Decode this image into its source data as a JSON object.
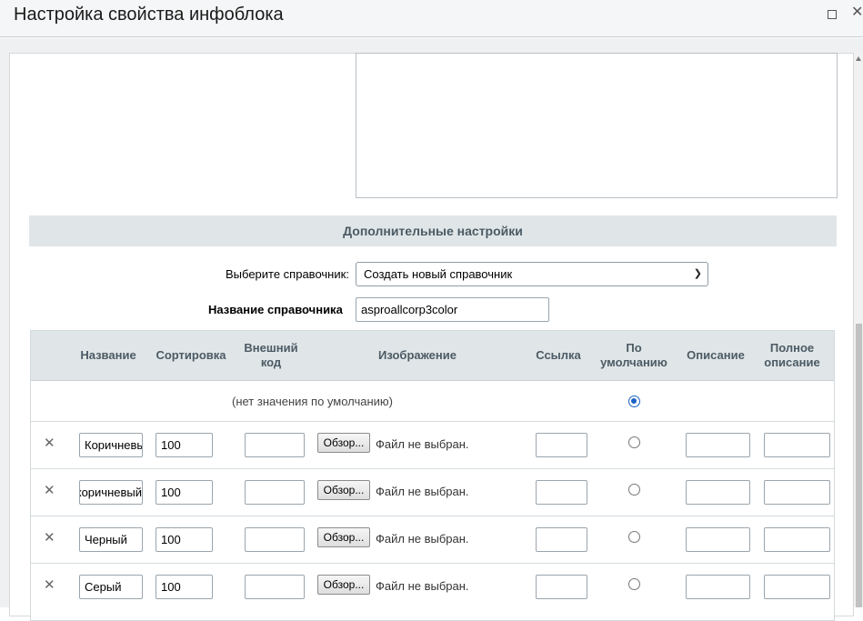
{
  "window": {
    "title": "Настройка свойства инфоблока"
  },
  "section": {
    "title": "Дополнительные настройки"
  },
  "directory": {
    "select_label": "Выберите справочник:",
    "select_value": "Создать новый справочник",
    "name_label": "Название справочника",
    "name_value": "asproallcorp3color"
  },
  "table": {
    "headers": {
      "name": "Название",
      "sort": "Сортировка",
      "ext_code": "Внешний\nкод",
      "image": "Изображение",
      "link": "Ссылка",
      "default": "По\nумолчанию",
      "description": "Описание",
      "full_description": "Полное\nописание"
    },
    "no_default": "(нет значения по умолчанию)",
    "browse_label": "Обзор...",
    "no_file": "Файл не выбран.",
    "rows": [
      {
        "name": "Коричневый",
        "sort": "100"
      },
      {
        "name": "Красно-коричневый",
        "sort": "100"
      },
      {
        "name": "Черный",
        "sort": "100"
      },
      {
        "name": "Серый",
        "sort": "100"
      }
    ]
  }
}
